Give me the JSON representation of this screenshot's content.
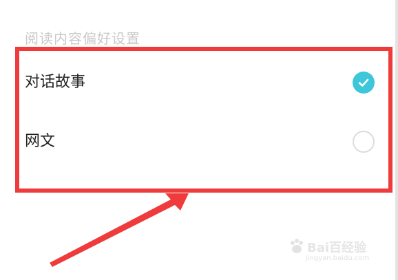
{
  "section": {
    "header": "阅读内容偏好设置"
  },
  "options": [
    {
      "label": "对话故事",
      "checked": true
    },
    {
      "label": "网文",
      "checked": false
    }
  ],
  "watermark": {
    "brand": "Bai百经验",
    "url": "jingyan.baidu.com"
  },
  "colors": {
    "accent": "#3dc7d8",
    "annotation": "#ef3b3b",
    "header_text": "#c9c9c9",
    "option_text": "#222222"
  },
  "icons": {
    "checked": "check-circle-icon",
    "unchecked": "empty-circle-icon"
  }
}
